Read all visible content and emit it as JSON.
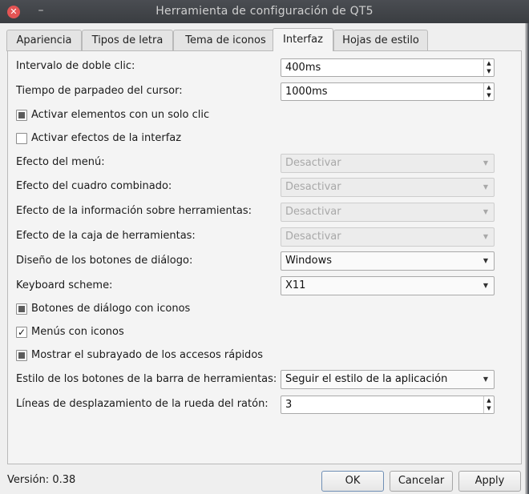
{
  "window": {
    "title": "Herramienta de configuración de QT5",
    "close_glyph": "✕",
    "minimize_glyph": "–"
  },
  "tabs": [
    {
      "label": "Apariencia"
    },
    {
      "label": "Tipos de letra"
    },
    {
      "label": "Tema de iconos"
    },
    {
      "label": "Interfaz"
    },
    {
      "label": "Hojas de estilo"
    }
  ],
  "active_tab": "Interfaz",
  "interface": {
    "double_click": {
      "label": "Intervalo de doble clic:",
      "value": "400ms"
    },
    "cursor_blink": {
      "label": "Tiempo de parpadeo del cursor:",
      "value": "1000ms"
    },
    "single_click": {
      "label": "Activar elementos con un solo clic",
      "state": "partial"
    },
    "ui_effects": {
      "label": "Activar efectos de la interfaz",
      "state": "unchecked"
    },
    "menu_effect": {
      "label": "Efecto del menú:",
      "value": "Desactivar"
    },
    "combo_effect": {
      "label": "Efecto del cuadro combinado:",
      "value": "Desactivar"
    },
    "tooltip_effect": {
      "label": "Efecto de la información sobre herramientas:",
      "value": "Desactivar"
    },
    "toolbox_effect": {
      "label": "Efecto de la caja de herramientas:",
      "value": "Desactivar"
    },
    "dialog_buttons_layout": {
      "label": "Diseño de los botones de diálogo:",
      "value": "Windows"
    },
    "keyboard_scheme": {
      "label": "Keyboard scheme:",
      "value": "X11"
    },
    "dialog_buttons_icons": {
      "label": "Botones de diálogo con iconos",
      "state": "partial"
    },
    "menus_icons": {
      "label": "Menús con iconos",
      "state": "checked",
      "glyph": "✓"
    },
    "shortcut_underline": {
      "label": "Mostrar el subrayado de los accesos rápidos",
      "state": "partial"
    },
    "toolbar_button_style": {
      "label": "Estilo de los botones de la barra de herramientas:",
      "value": "Seguir el estilo de la aplicación"
    },
    "wheel_scroll_lines": {
      "label": "Líneas de desplazamiento de la rueda del ratón:",
      "value": "3"
    }
  },
  "footer": {
    "version": "Versión: 0.38",
    "ok": "OK",
    "cancel": "Cancelar",
    "apply": "Apply"
  },
  "glyphs": {
    "up": "▲",
    "down": "▼"
  },
  "colors": {
    "titlebar": "#3a3d41",
    "close": "#e45454",
    "background": "#efefef"
  }
}
